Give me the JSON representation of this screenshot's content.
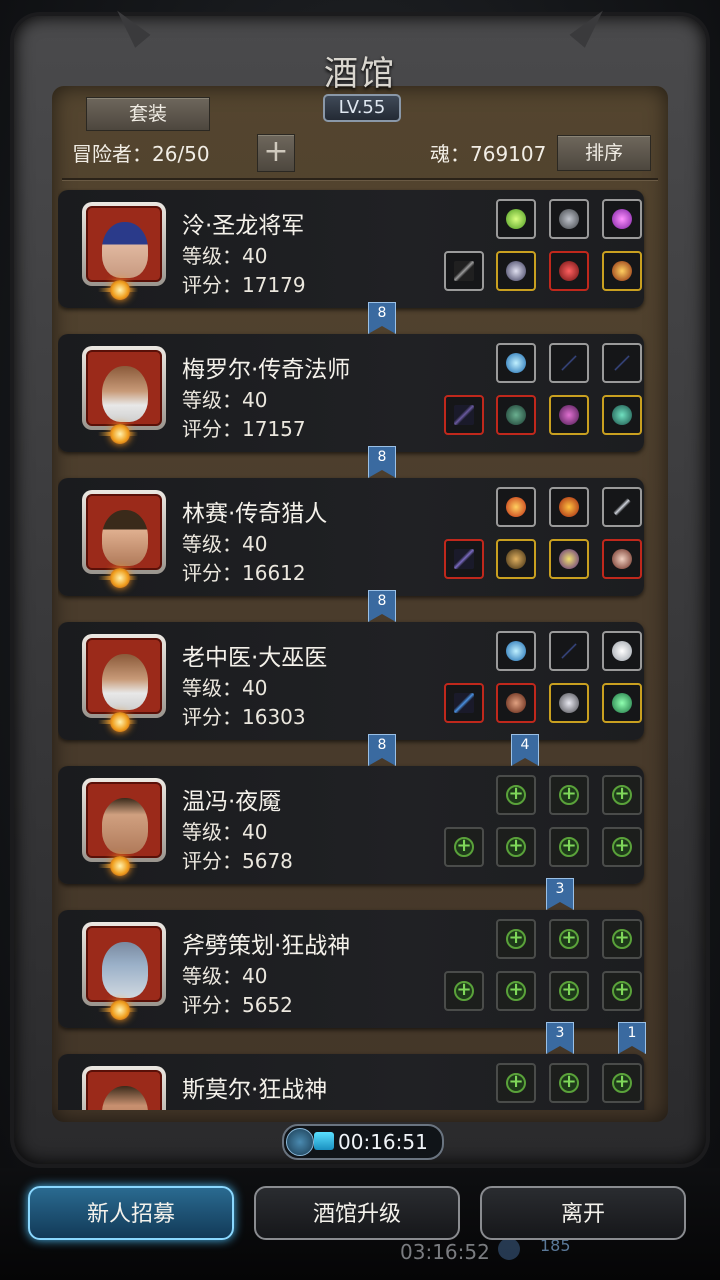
{
  "header": {
    "title": "酒馆",
    "level": "LV.55",
    "suit_label": "套装",
    "adventurers_label": "冒险者：26/50",
    "soul_label": "魂：769107",
    "sort_label": "排序",
    "add_symbol": "+"
  },
  "heroes": [
    {
      "name": "泠·圣龙将军",
      "level": "等级：40",
      "score": "评分：17179"
    },
    {
      "name": "梅罗尔·传奇法师",
      "level": "等级：40",
      "score": "评分：17157"
    },
    {
      "name": "林赛·传奇猎人",
      "level": "等级：40",
      "score": "评分：16612"
    },
    {
      "name": "老中医·大巫医",
      "level": "等级：40",
      "score": "评分：16303"
    },
    {
      "name": "温冯·夜魇",
      "level": "等级：40",
      "score": "评分：5678"
    },
    {
      "name": "斧劈策划·狂战神",
      "level": "等级：40",
      "score": "评分：5652"
    },
    {
      "name": "斯莫尔·狂战神",
      "level": "",
      "score": ""
    }
  ],
  "ribbons": [
    "8",
    "8",
    "8",
    "8",
    "4",
    "3",
    "3",
    "1"
  ],
  "timer": "00:16:51",
  "buttons": {
    "recruit": "新人招募",
    "upgrade": "酒馆升级",
    "leave": "离开"
  },
  "background": {
    "ghost_time": "03:16:52",
    "ghost_count": "185"
  },
  "colors": {
    "panel": "#4b3e2f",
    "card": "#1f2023",
    "accent": "#4ab8f0",
    "ribbon": "#3a6aa0"
  }
}
